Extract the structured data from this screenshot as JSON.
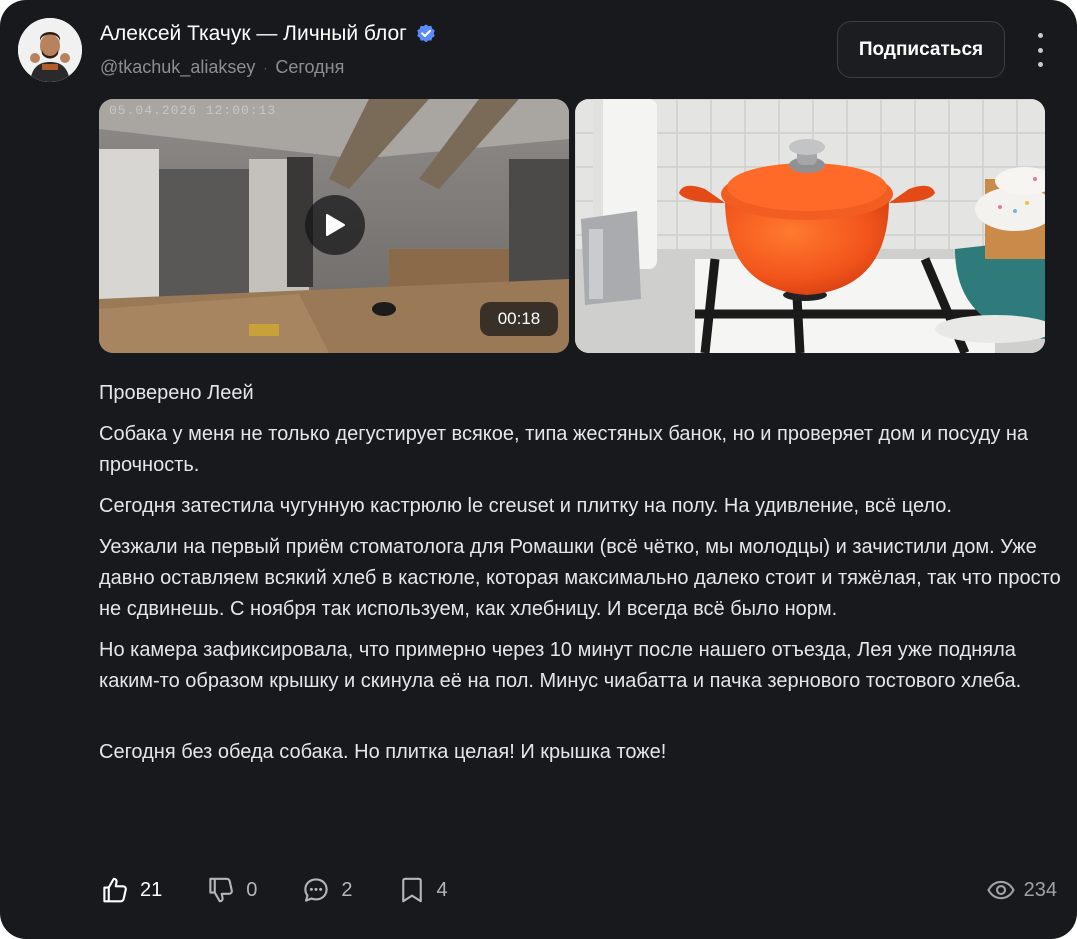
{
  "author": {
    "name": "Алексей Ткачук — Личный блог",
    "handle": "@tkachuk_aliaksey",
    "separator": "·",
    "date": "Сегодня",
    "verified": true
  },
  "header": {
    "subscribe_label": "Подписаться"
  },
  "media": {
    "video": {
      "camera_timestamp": "05.04.2026 12:00:13",
      "duration": "00:18"
    }
  },
  "post": {
    "paragraphs": [
      "Проверено Леей",
      "Собака у меня не только дегустирует всякое, типа жестяных банок, но и проверяет дом и посуду на прочность.",
      "Сегодня затестила чугунную кастрюлю le creuset и плитку на полу. На удивление, всё цело.",
      "Уезжали на первый приём стоматолога для Ромашки (всё чётко, мы молодцы) и зачистили дом. Уже давно оставляем всякий хлеб в кастюле, которая максимально далеко стоит и тяжёлая, так что просто не сдвинешь. С ноября так используем, как хлебницу. И всегда всё было норм.",
      "Но камера зафиксировала, что примерно через 10 минут после нашего отъезда, Лея уже подняла каким-то образом крышку и скинула её на пол. Минус чиабатта и пачка зернового тостового хлеба.",
      "Сегодня без обеда собака. Но плитка целая! И крышка тоже!"
    ]
  },
  "actions": {
    "likes": "21",
    "dislikes": "0",
    "comments": "2",
    "bookmarks": "4",
    "views": "234"
  },
  "colors": {
    "card_background": "#18191c",
    "verified_badge": "#5b8cff",
    "pot_orange": "#f2541b"
  }
}
